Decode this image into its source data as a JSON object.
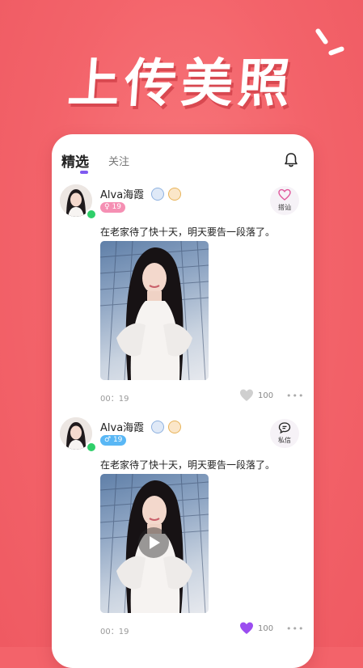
{
  "banner": {
    "title": "上传美照"
  },
  "tabs": {
    "active": "精选",
    "other": "关注"
  },
  "posts": [
    {
      "name": "Alva海霞",
      "gender_symbol": "♀",
      "age": "19",
      "action_label": "搭讪",
      "action_icon": "heart-outline-icon",
      "content": "在老家待了快十天，明天要告一段落了。",
      "time": "00：19",
      "likes": "100",
      "liked": false,
      "media": "photo"
    },
    {
      "name": "Alva海霞",
      "gender_symbol": "♂",
      "age": "19",
      "action_label": "私信",
      "action_icon": "chat-bubble-icon",
      "content": "在老家待了快十天，明天要告一段落了。",
      "time": "00：19",
      "likes": "100",
      "liked": true,
      "media": "video"
    }
  ],
  "colors": {
    "background": "#f3636a",
    "accent": "#7f5af0",
    "online": "#2fcf6a",
    "liked": "#9b4df0"
  }
}
